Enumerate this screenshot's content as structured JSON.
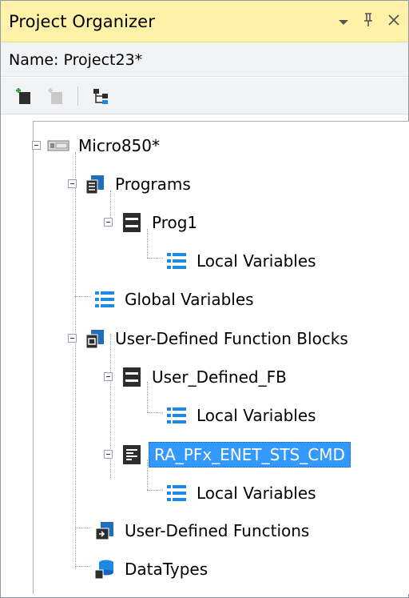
{
  "panel": {
    "title": "Project Organizer",
    "controls": {
      "dropdown": "▾",
      "pin": "ᵖ",
      "close": "✕"
    },
    "name_label": "Name:",
    "name_value": "Project23*"
  },
  "tree": {
    "items": [
      {
        "label": "Micro850*",
        "icon": "controller-icon"
      },
      {
        "label": "Programs",
        "icon": "programs-folder-icon"
      },
      {
        "label": "Prog1",
        "icon": "program-icon"
      },
      {
        "label": "Local Variables",
        "icon": "variables-list-icon"
      },
      {
        "label": "Global Variables",
        "icon": "variables-list-icon"
      },
      {
        "label": "User-Defined Function Blocks",
        "icon": "function-blocks-folder-icon"
      },
      {
        "label": "User_Defined_FB",
        "icon": "function-block-icon"
      },
      {
        "label": "Local Variables",
        "icon": "variables-list-icon"
      },
      {
        "label": "RA_PFx_ENET_STS_CMD",
        "icon": "function-block-text-icon",
        "selected": true
      },
      {
        "label": "Local Variables",
        "icon": "variables-list-icon"
      },
      {
        "label": "User-Defined Functions",
        "icon": "functions-folder-icon"
      },
      {
        "label": "DataTypes",
        "icon": "datatypes-icon"
      }
    ]
  },
  "colors": {
    "title_bar": "#fff2a8",
    "selection": "#3399ff",
    "list_icon_blue": "#1e88e5"
  }
}
